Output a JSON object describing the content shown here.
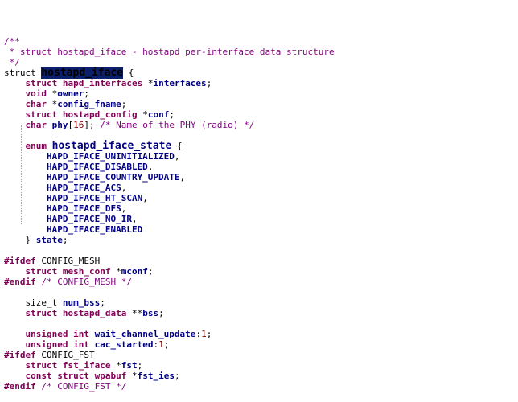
{
  "colors": {
    "keyword": "#7f0055",
    "identifier": "#000080",
    "comment": "#7f007f",
    "number": "#800000",
    "selection": "#0b1f6b"
  },
  "lines": [
    [
      {
        "t": "/**",
        "c": "cm"
      }
    ],
    [
      {
        "t": " * struct hostapd_iface - hostapd per-interface data structure",
        "c": "cm"
      }
    ],
    [
      {
        "t": " */",
        "c": "cm"
      }
    ],
    [
      {
        "t": "struct ",
        "c": "pl"
      },
      {
        "t": "hostapd_iface",
        "c": "sel kw-big"
      },
      {
        "t": " {",
        "c": "pl"
      }
    ],
    [
      {
        "t": "    struct ",
        "c": "kw"
      },
      {
        "t": "hapd_interfaces ",
        "c": "ty"
      },
      {
        "t": "*",
        "c": "pl"
      },
      {
        "t": "interfaces",
        "c": "id"
      },
      {
        "t": ";",
        "c": "pl"
      }
    ],
    [
      {
        "t": "    void ",
        "c": "kw"
      },
      {
        "t": "*",
        "c": "pl"
      },
      {
        "t": "owner",
        "c": "id"
      },
      {
        "t": ";",
        "c": "pl"
      }
    ],
    [
      {
        "t": "    char ",
        "c": "kw"
      },
      {
        "t": "*",
        "c": "pl"
      },
      {
        "t": "config_fname",
        "c": "id"
      },
      {
        "t": ";",
        "c": "pl"
      }
    ],
    [
      {
        "t": "    struct ",
        "c": "kw"
      },
      {
        "t": "hostapd_config ",
        "c": "ty"
      },
      {
        "t": "*",
        "c": "pl"
      },
      {
        "t": "conf",
        "c": "id"
      },
      {
        "t": ";",
        "c": "pl"
      }
    ],
    [
      {
        "t": "    char ",
        "c": "kw"
      },
      {
        "t": "phy",
        "c": "id"
      },
      {
        "t": "[",
        "c": "pl"
      },
      {
        "t": "16",
        "c": "nm"
      },
      {
        "t": "]; ",
        "c": "pl"
      },
      {
        "t": "/* Name of the PHY (radio) */",
        "c": "cm"
      }
    ],
    [
      {
        "t": "",
        "c": "pl"
      }
    ],
    [
      {
        "t": "    enum ",
        "c": "kw"
      },
      {
        "t": "hostapd_iface_state",
        "c": "id-big"
      },
      {
        "t": " {",
        "c": "pl"
      }
    ],
    [
      {
        "t": "        HAPD_IFACE_UNINITIALIZED",
        "c": "id"
      },
      {
        "t": ",",
        "c": "pl"
      }
    ],
    [
      {
        "t": "        HAPD_IFACE_DISABLED",
        "c": "id"
      },
      {
        "t": ",",
        "c": "pl"
      }
    ],
    [
      {
        "t": "        HAPD_IFACE_COUNTRY_UPDATE",
        "c": "id"
      },
      {
        "t": ",",
        "c": "pl"
      }
    ],
    [
      {
        "t": "        HAPD_IFACE_ACS",
        "c": "id"
      },
      {
        "t": ",",
        "c": "pl"
      }
    ],
    [
      {
        "t": "        HAPD_IFACE_HT_SCAN",
        "c": "id"
      },
      {
        "t": ",",
        "c": "pl"
      }
    ],
    [
      {
        "t": "        HAPD_IFACE_DFS",
        "c": "id"
      },
      {
        "t": ",",
        "c": "pl"
      }
    ],
    [
      {
        "t": "        HAPD_IFACE_NO_IR",
        "c": "id"
      },
      {
        "t": ",",
        "c": "pl"
      }
    ],
    [
      {
        "t": "        HAPD_IFACE_ENABLED",
        "c": "id"
      }
    ],
    [
      {
        "t": "    } ",
        "c": "pl"
      },
      {
        "t": "state",
        "c": "id"
      },
      {
        "t": ";",
        "c": "pl"
      }
    ],
    [
      {
        "t": "",
        "c": "pl"
      }
    ],
    [
      {
        "t": "#ifdef ",
        "c": "kw"
      },
      {
        "t": "CONFIG_MESH",
        "c": "pl"
      }
    ],
    [
      {
        "t": "    struct ",
        "c": "kw"
      },
      {
        "t": "mesh_conf ",
        "c": "ty"
      },
      {
        "t": "*",
        "c": "pl"
      },
      {
        "t": "mconf",
        "c": "id"
      },
      {
        "t": ";",
        "c": "pl"
      }
    ],
    [
      {
        "t": "#endif ",
        "c": "kw"
      },
      {
        "t": "/* CONFIG_MESH */",
        "c": "cm"
      }
    ],
    [
      {
        "t": "",
        "c": "pl"
      }
    ],
    [
      {
        "t": "    size_t ",
        "c": "pl"
      },
      {
        "t": "num_bss",
        "c": "id"
      },
      {
        "t": ";",
        "c": "pl"
      }
    ],
    [
      {
        "t": "    struct ",
        "c": "kw"
      },
      {
        "t": "hostapd_data ",
        "c": "ty"
      },
      {
        "t": "**",
        "c": "pl"
      },
      {
        "t": "bss",
        "c": "id"
      },
      {
        "t": ";",
        "c": "pl"
      }
    ],
    [
      {
        "t": "",
        "c": "pl"
      }
    ],
    [
      {
        "t": "    unsigned int ",
        "c": "kw"
      },
      {
        "t": "wait_channel_update",
        "c": "id"
      },
      {
        "t": ":",
        "c": "pl"
      },
      {
        "t": "1",
        "c": "nm"
      },
      {
        "t": ";",
        "c": "pl"
      }
    ],
    [
      {
        "t": "    unsigned int ",
        "c": "kw"
      },
      {
        "t": "cac_started",
        "c": "id"
      },
      {
        "t": ":",
        "c": "pl"
      },
      {
        "t": "1",
        "c": "nm"
      },
      {
        "t": ";",
        "c": "pl"
      }
    ],
    [
      {
        "t": "#ifdef ",
        "c": "kw"
      },
      {
        "t": "CONFIG_FST",
        "c": "pl"
      }
    ],
    [
      {
        "t": "    struct ",
        "c": "kw"
      },
      {
        "t": "fst_iface ",
        "c": "ty"
      },
      {
        "t": "*",
        "c": "pl"
      },
      {
        "t": "fst",
        "c": "id"
      },
      {
        "t": ";",
        "c": "pl"
      }
    ],
    [
      {
        "t": "    const struct ",
        "c": "kw"
      },
      {
        "t": "wpabuf ",
        "c": "ty"
      },
      {
        "t": "*",
        "c": "pl"
      },
      {
        "t": "fst_ies",
        "c": "id"
      },
      {
        "t": ";",
        "c": "pl"
      }
    ],
    [
      {
        "t": "#endif ",
        "c": "kw"
      },
      {
        "t": "/* CONFIG_FST */",
        "c": "cm"
      }
    ]
  ]
}
